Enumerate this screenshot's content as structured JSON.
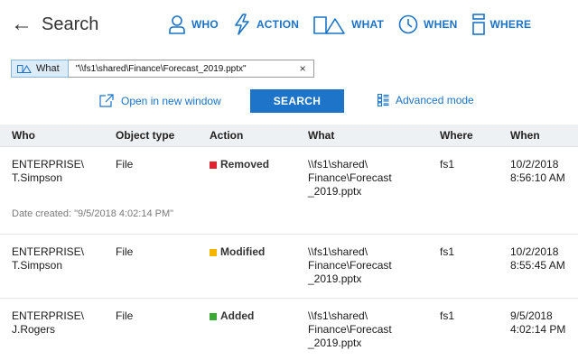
{
  "header": {
    "title": "Search",
    "nav": [
      {
        "label": "WHO",
        "icon": "person-icon"
      },
      {
        "label": "ACTION",
        "icon": "lightning-icon"
      },
      {
        "label": "WHAT",
        "icon": "object-icon"
      },
      {
        "label": "WHEN",
        "icon": "clock-icon"
      },
      {
        "label": "WHERE",
        "icon": "server-icon"
      }
    ]
  },
  "filter": {
    "chip_label": "What",
    "query_value": "\"\\\\fs1\\shared\\Finance\\Forecast_2019.pptx\"",
    "clear_symbol": "×"
  },
  "actions": {
    "open_window": "Open in new window",
    "search": "SEARCH",
    "advanced": "Advanced mode"
  },
  "table": {
    "headers": [
      "Who",
      "Object type",
      "Action",
      "What",
      "Where",
      "When"
    ],
    "rows": [
      {
        "who": "ENTERPRISE\\\nT.Simpson",
        "object_type": "File",
        "action": "Removed",
        "action_color": "#e0232e",
        "what": "\\\\fs1\\shared\\\nFinance\\Forecast\n_2019.pptx",
        "where": "fs1",
        "when": "10/2/2018\n8:56:10 AM",
        "meta": "Date created: \"9/5/2018 4:02:14 PM\""
      },
      {
        "who": "ENTERPRISE\\\nT.Simpson",
        "object_type": "File",
        "action": "Modified",
        "action_color": "#f5b400",
        "what": "\\\\fs1\\shared\\\nFinance\\Forecast\n_2019.pptx",
        "where": "fs1",
        "when": "10/2/2018\n8:55:45 AM"
      },
      {
        "who": "ENTERPRISE\\\nJ.Rogers",
        "object_type": "File",
        "action": "Added",
        "action_color": "#3aaa35",
        "what": "\\\\fs1\\shared\\\nFinance\\Forecast\n_2019.pptx",
        "where": "fs1",
        "when": "9/5/2018\n4:02:14 PM"
      }
    ]
  },
  "colors": {
    "accent": "#1d74c9",
    "header_bg": "#eef1f4"
  }
}
